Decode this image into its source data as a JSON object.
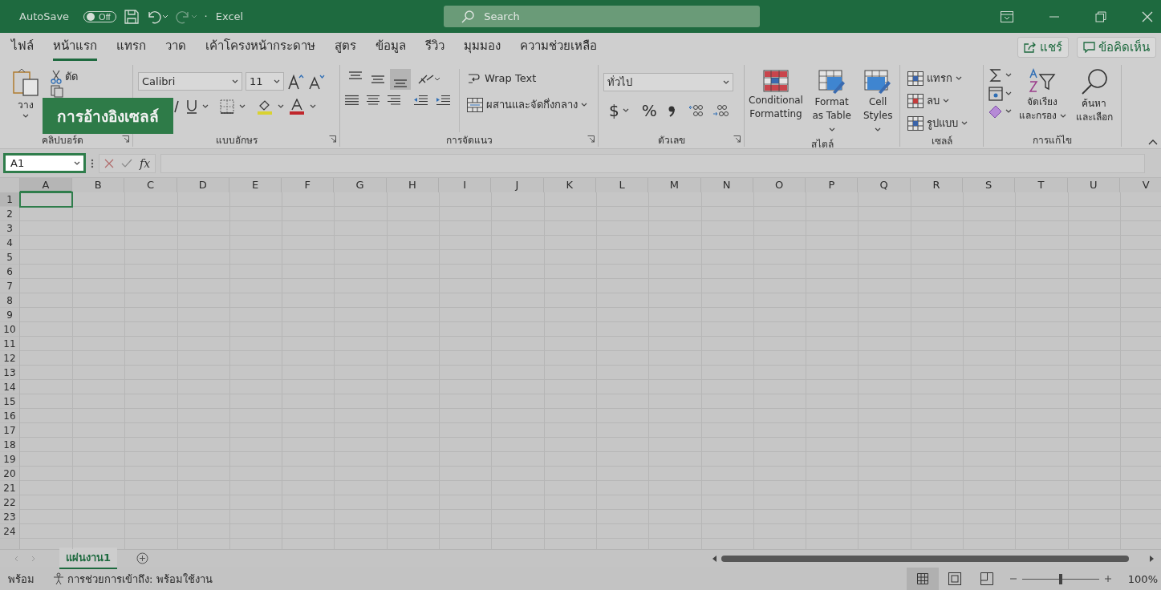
{
  "title_bar": {
    "autosave_label": "AutoSave",
    "autosave_toggle": {
      "label": "Off",
      "on": false
    },
    "separator": "·",
    "app_name": "Excel",
    "search": {
      "placeholder": "Search"
    }
  },
  "menu_tabs": [
    {
      "label": "ไฟล์",
      "selected": false
    },
    {
      "label": "หน้าแรก",
      "selected": true
    },
    {
      "label": "แทรก",
      "selected": false
    },
    {
      "label": "วาด",
      "selected": false
    },
    {
      "label": "เค้าโครงหน้ากระดาษ",
      "selected": false
    },
    {
      "label": "สูตร",
      "selected": false
    },
    {
      "label": "ข้อมูล",
      "selected": false
    },
    {
      "label": "รีวิว",
      "selected": false
    },
    {
      "label": "มุมมอง",
      "selected": false
    },
    {
      "label": "ความช่วยเหลือ",
      "selected": false
    }
  ],
  "share_button": "แชร์",
  "comments_button": "ข้อคิดเห็น",
  "ribbon": {
    "clipboard": {
      "label": "คลิปบอร์ด",
      "paste": "วาง",
      "cut": "ตัด"
    },
    "font": {
      "label": "แบบอักษร",
      "font_name": "Calibri",
      "font_size": "11"
    },
    "alignment": {
      "label": "การจัดแนว",
      "vertical_align": [
        {
          "kind": "top",
          "selected": false
        },
        {
          "kind": "middle",
          "selected": false
        },
        {
          "kind": "bottom",
          "selected": true
        }
      ],
      "wrap_text": "Wrap Text",
      "merge": "ผสานและจัดกึ่งกลาง"
    },
    "number": {
      "label": "ตัวเลข",
      "format": "ทั่วไป",
      "currency": "$",
      "percent": "%"
    },
    "styles": {
      "label": "สไตล์",
      "buttons": [
        {
          "kind": "conditional",
          "label": "Conditional Formatting"
        },
        {
          "kind": "table",
          "label": "Format as Table"
        },
        {
          "kind": "cell",
          "label": "Cell Styles"
        }
      ]
    },
    "cells": {
      "label": "เซลล์",
      "buttons": [
        {
          "kind": "insert",
          "label": "แทรก"
        },
        {
          "kind": "delete",
          "label": "ลบ"
        },
        {
          "kind": "format",
          "label": "รูปแบบ"
        }
      ]
    },
    "editing": {
      "label": "การแก้ไข",
      "sort_filter": [
        "จัดเรียง",
        "และกรอง"
      ],
      "find_select": [
        "ค้นหา",
        "และเลือก"
      ]
    }
  },
  "callout": "การอ้างอิงเซลล์",
  "formula_bar": {
    "name_box": "A1",
    "function_label": "fx"
  },
  "columns": [
    {
      "label": "A",
      "selected": true
    },
    {
      "label": "B",
      "selected": false
    },
    {
      "label": "C",
      "selected": false
    },
    {
      "label": "D",
      "selected": false
    },
    {
      "label": "E",
      "selected": false
    },
    {
      "label": "F",
      "selected": false
    },
    {
      "label": "G",
      "selected": false
    },
    {
      "label": "H",
      "selected": false
    },
    {
      "label": "I",
      "selected": false
    },
    {
      "label": "J",
      "selected": false
    },
    {
      "label": "K",
      "selected": false
    },
    {
      "label": "L",
      "selected": false
    },
    {
      "label": "M",
      "selected": false
    },
    {
      "label": "N",
      "selected": false
    },
    {
      "label": "O",
      "selected": false
    },
    {
      "label": "P",
      "selected": false
    },
    {
      "label": "Q",
      "selected": false
    },
    {
      "label": "R",
      "selected": false
    },
    {
      "label": "S",
      "selected": false
    },
    {
      "label": "T",
      "selected": false
    },
    {
      "label": "U",
      "selected": false
    },
    {
      "label": "V",
      "selected": false
    }
  ],
  "rows": [
    {
      "label": "1",
      "selected": true
    },
    {
      "label": "2",
      "selected": false
    },
    {
      "label": "3",
      "selected": false
    },
    {
      "label": "4",
      "selected": false
    },
    {
      "label": "5",
      "selected": false
    },
    {
      "label": "6",
      "selected": false
    },
    {
      "label": "7",
      "selected": false
    },
    {
      "label": "8",
      "selected": false
    },
    {
      "label": "9",
      "selected": false
    },
    {
      "label": "10",
      "selected": false
    },
    {
      "label": "11",
      "selected": false
    },
    {
      "label": "12",
      "selected": false
    },
    {
      "label": "13",
      "selected": false
    },
    {
      "label": "14",
      "selected": false
    },
    {
      "label": "15",
      "selected": false
    },
    {
      "label": "16",
      "selected": false
    },
    {
      "label": "17",
      "selected": false
    },
    {
      "label": "18",
      "selected": false
    },
    {
      "label": "19",
      "selected": false
    },
    {
      "label": "20",
      "selected": false
    },
    {
      "label": "21",
      "selected": false
    },
    {
      "label": "22",
      "selected": false
    },
    {
      "label": "23",
      "selected": false
    },
    {
      "label": "24",
      "selected": false
    }
  ],
  "sheet_tabs": [
    {
      "label": "แผ่นงาน1",
      "selected": true
    }
  ],
  "status_bar": {
    "ready": "พร้อม",
    "accessibility": "การช่วยการเข้าถึง: พร้อมใช้งาน",
    "views": [
      {
        "kind": "normal",
        "selected": true
      },
      {
        "kind": "page_layout",
        "selected": false
      },
      {
        "kind": "page_break",
        "selected": false
      }
    ],
    "zoom": {
      "level": 0.5,
      "reading": "100%"
    }
  }
}
